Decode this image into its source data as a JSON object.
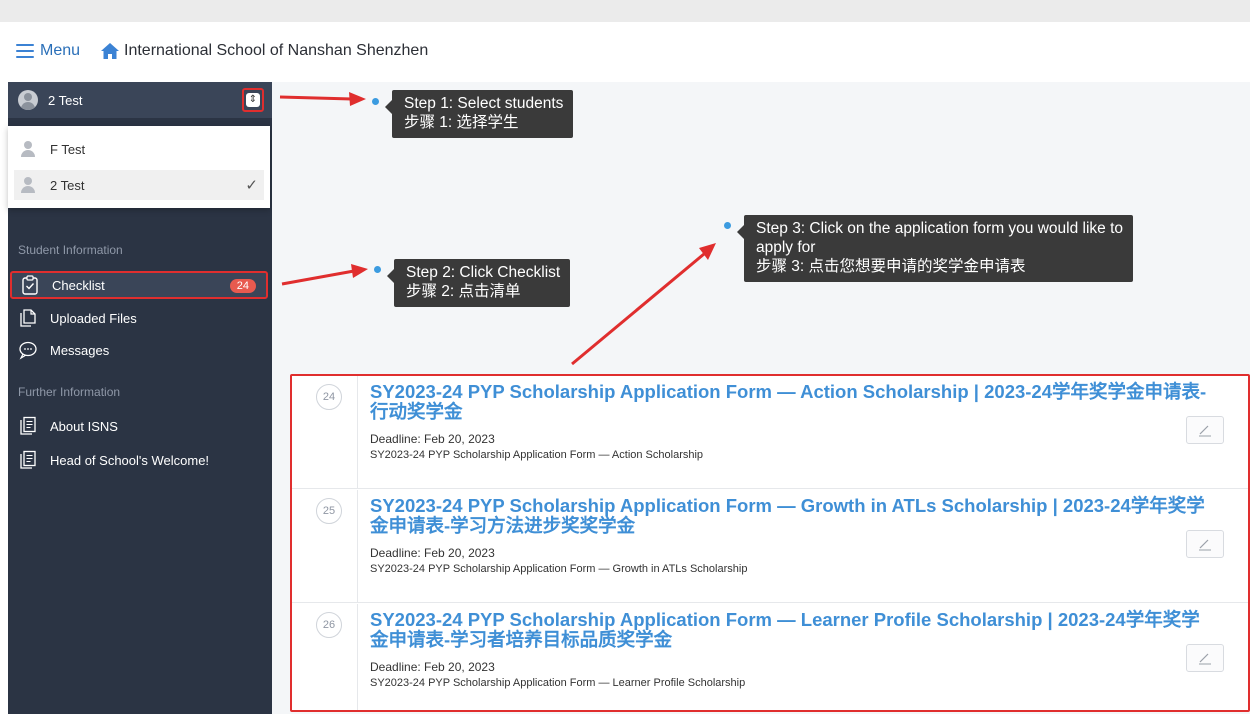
{
  "topbar": {
    "menu_label": "Menu",
    "school_name": "International School of Nanshan Shenzhen"
  },
  "sidebar": {
    "current_student": "2 Test",
    "students": [
      {
        "name": "F Test",
        "selected": false
      },
      {
        "name": "2 Test",
        "selected": true
      }
    ],
    "section_student_info": "Student Information",
    "section_further_info": "Further Information",
    "items": [
      {
        "label": "Checklist",
        "icon": "checklist-icon",
        "badge": "24",
        "active": true
      },
      {
        "label": "Uploaded Files",
        "icon": "files-icon"
      },
      {
        "label": "Messages",
        "icon": "messages-icon"
      },
      {
        "label": "About ISNS",
        "icon": "document-icon"
      },
      {
        "label": "Head of School's Welcome!",
        "icon": "document-icon"
      }
    ]
  },
  "callouts": {
    "step1_en": "Step 1: Select students",
    "step1_zh": "步骤 1: 选择学生",
    "step2_en": "Step 2: Click Checklist",
    "step2_zh": "步骤 2: 点击清单",
    "step3_en_line1": "Step 3: Click on the application form you would like to",
    "step3_en_line2": "apply for",
    "step3_zh": "步骤 3: 点击您想要申请的奖学金申请表"
  },
  "forms": [
    {
      "number": "24",
      "title": "SY2023-24 PYP Scholarship Application Form — Action Scholarship | 2023-24学年奖学金申请表-行动奖学金",
      "deadline": "Deadline: Feb 20, 2023",
      "description": "SY2023-24 PYP Scholarship Application Form — Action Scholarship"
    },
    {
      "number": "25",
      "title": "SY2023-24 PYP Scholarship Application Form — Growth in ATLs Scholarship | 2023-24学年奖学金申请表-学习方法进步奖奖学金",
      "deadline": "Deadline: Feb 20, 2023",
      "description": "SY2023-24 PYP Scholarship Application Form — Growth in ATLs Scholarship"
    },
    {
      "number": "26",
      "title": "SY2023-24 PYP Scholarship Application Form — Learner Profile Scholarship | 2023-24学年奖学金申请表-学习者培养目标品质奖学金",
      "deadline": "Deadline: Feb 20, 2023",
      "description": "SY2023-24 PYP Scholarship Application Form — Learner Profile Scholarship"
    }
  ],
  "colors": {
    "sidebar_bg": "#2b3444",
    "accent_blue": "#3f8fd6",
    "annotation_red": "#e02e2e",
    "callout_bg": "#3a3a3a"
  }
}
